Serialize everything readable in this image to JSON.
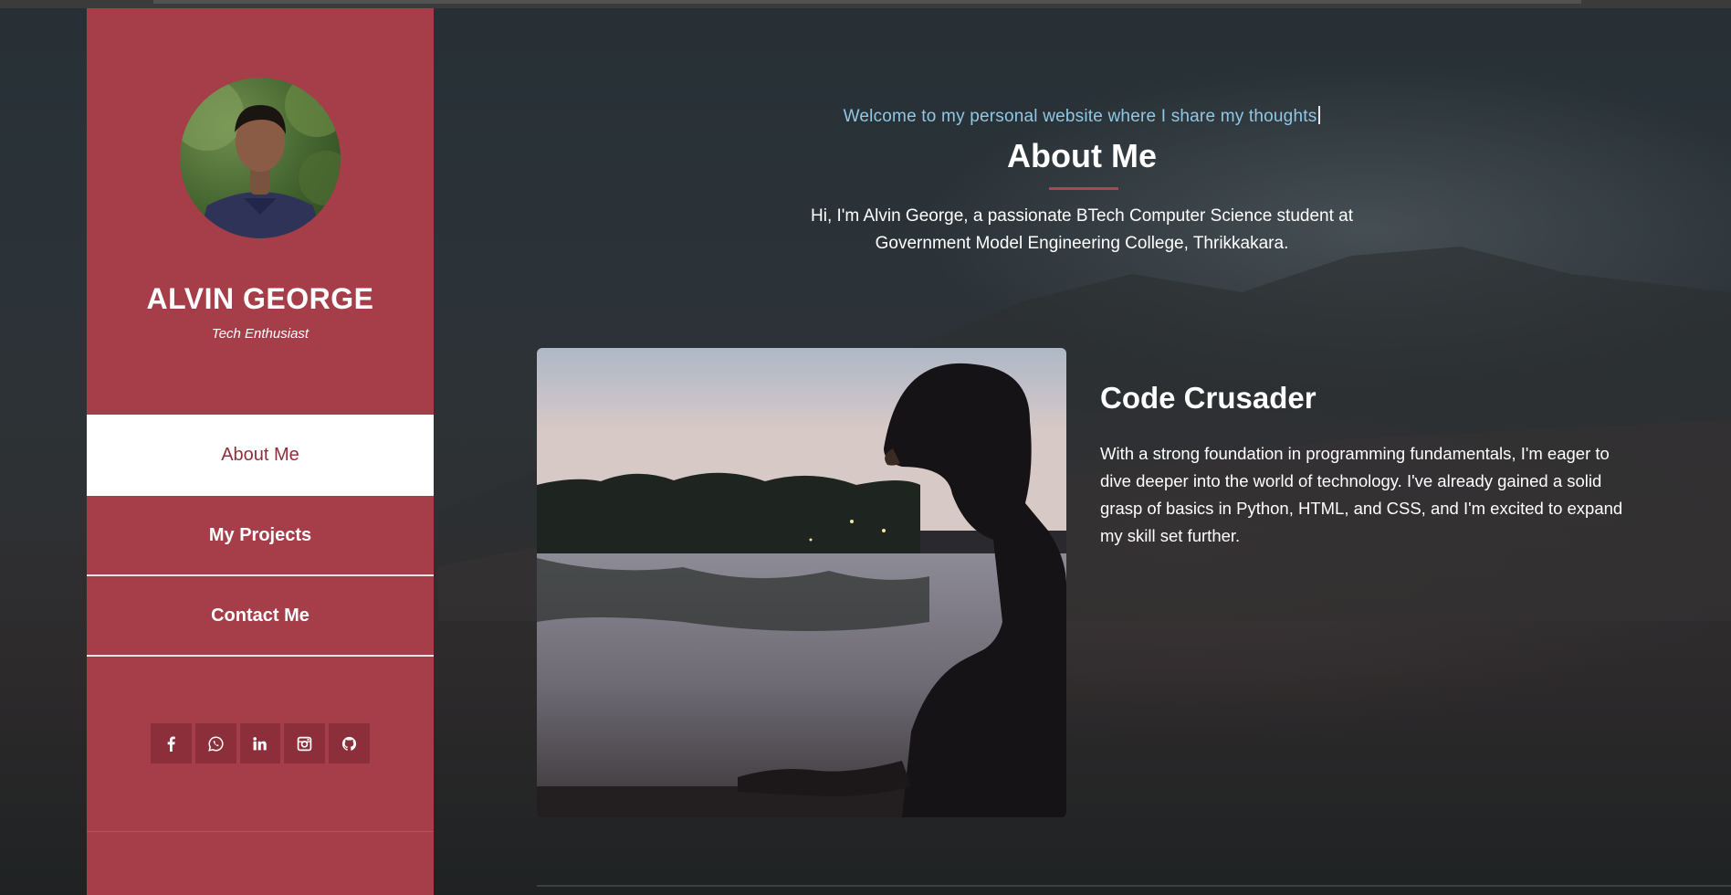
{
  "sidebar": {
    "name": "ALVIN GEORGE",
    "tagline": "Tech Enthusiast",
    "nav": [
      {
        "label": "About Me",
        "active": true
      },
      {
        "label": "My Projects",
        "active": false
      },
      {
        "label": "Contact Me",
        "active": false
      }
    ],
    "socials": [
      "facebook-icon",
      "whatsapp-icon",
      "linkedin-icon",
      "instagram-icon",
      "github-icon"
    ],
    "color": "#a63e4a"
  },
  "main": {
    "welcome": "Welcome to my personal website where I share my thoughts",
    "title": "About Me",
    "intro_line1": "Hi, I'm Alvin George, a passionate BTech Computer Science student at",
    "intro_line2": "Government Model Engineering College, Thrikkakara.",
    "card": {
      "title": "Code Crusader",
      "text": "With a strong foundation in programming fundamentals, I'm eager to dive deeper into the world of technology. I've already gained a solid grasp of basics in Python, HTML, and CSS, and I'm excited to expand my skill set further."
    },
    "accent": "#b04653",
    "welcome_color": "#8fc7e4"
  }
}
